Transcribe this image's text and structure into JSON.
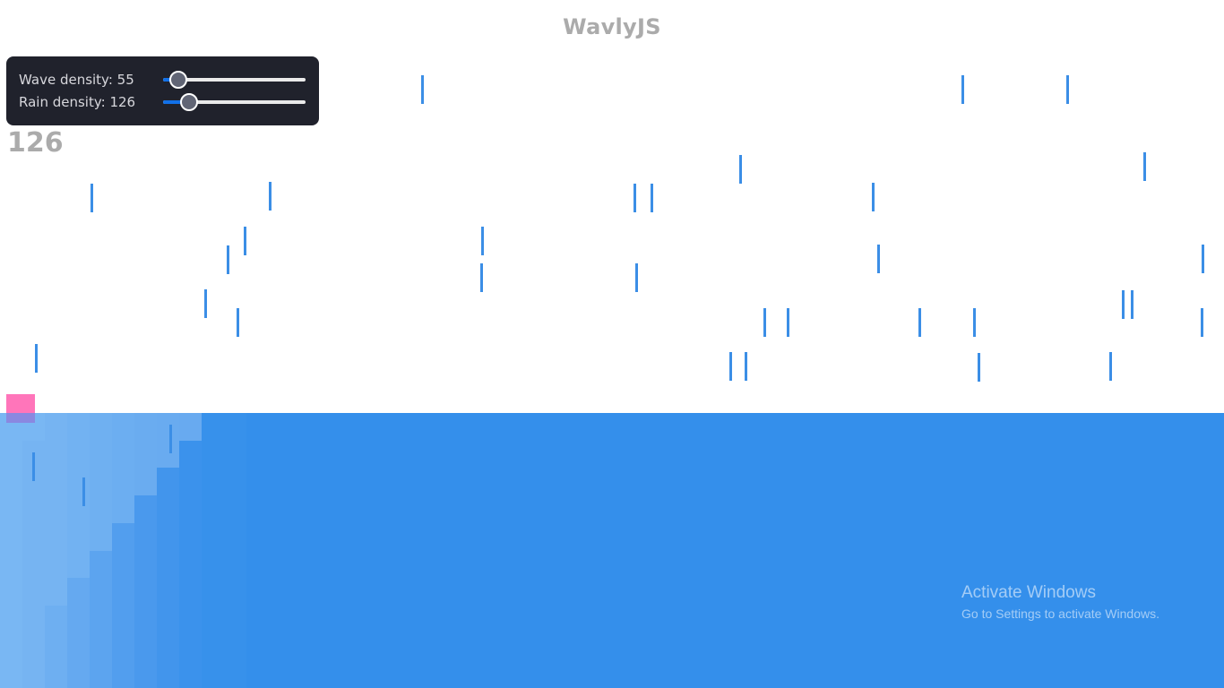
{
  "app": {
    "title": "WavlyJS"
  },
  "controls": {
    "wave_label": "Wave density: 55",
    "wave_value": 55,
    "wave_level": 0.11,
    "rain_label": "Rain density: 126",
    "rain_value": 126,
    "rain_level": 0.18
  },
  "counter": "126",
  "watermark": {
    "title": "Activate Windows",
    "subtitle": "Go to Settings to activate Windows."
  },
  "colors": {
    "water": "#348feb",
    "rain": "#3b8ee6",
    "player": "#ff69b4",
    "panel": "#20222c"
  }
}
